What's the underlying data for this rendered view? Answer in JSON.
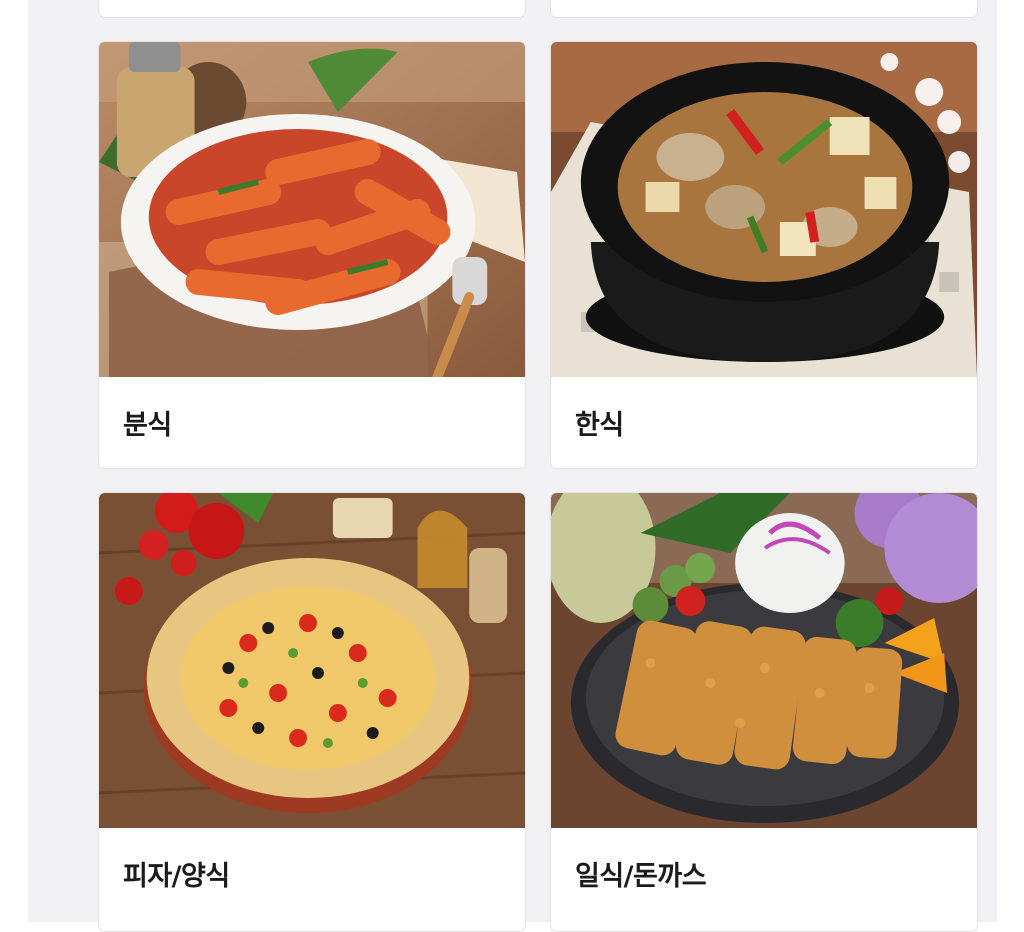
{
  "categories": [
    {
      "id": "bunsik",
      "label": "분식",
      "image_icon": "tteokbokki-image"
    },
    {
      "id": "hansik",
      "label": "한식",
      "image_icon": "stew-pot-image"
    },
    {
      "id": "pizza",
      "label": "피자/양식",
      "image_icon": "pizza-image"
    },
    {
      "id": "japanese",
      "label": "일식/돈까스",
      "image_icon": "tonkatsu-image"
    }
  ],
  "colors": {
    "panel_bg": "#f1f1f3",
    "card_bg": "#ffffff",
    "label_text": "#1b1b1b"
  }
}
